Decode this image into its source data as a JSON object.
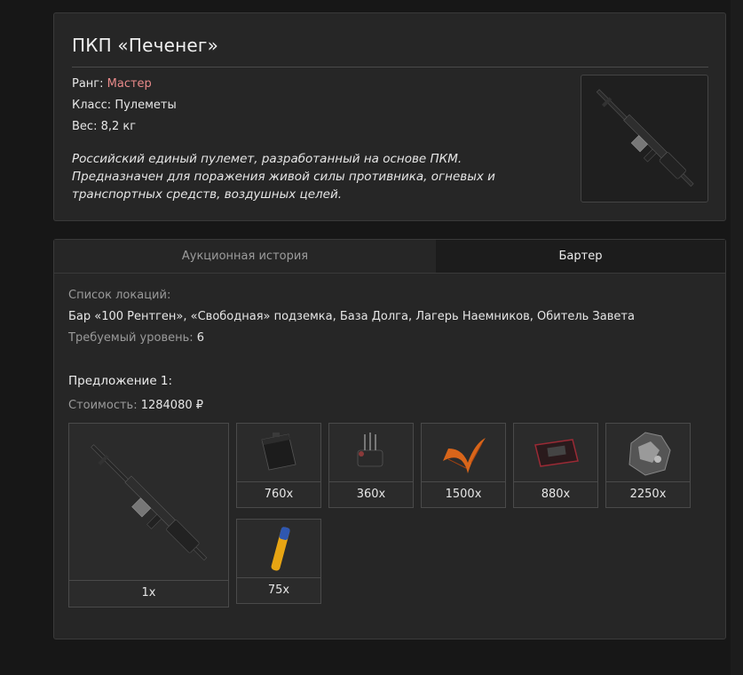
{
  "item": {
    "title": "ПКП «Печенег»",
    "rank_label": "Ранг:",
    "rank_value": "Мастер",
    "class_label": "Класс:",
    "class_value": "Пулеметы",
    "weight_label": "Вес:",
    "weight_value": "8,2 кг",
    "description": "Российский единый пулемет, разработанный на основе ПКМ. Предназначен для поражения живой силы противника, огневых и транспортных средств, воздушных целей.",
    "rank_color": "#e98a8a"
  },
  "tabs": [
    {
      "label": "Аукционная история",
      "active": false
    },
    {
      "label": "Бартер",
      "active": true
    }
  ],
  "barter": {
    "locations_label": "Список локаций:",
    "locations_value": "Бар «100 Рентген», «Свободная» подземка, База Долга, Лагерь Наемников, Обитель Завета",
    "level_label": "Требуемый уровень:",
    "level_value": "6",
    "offer_title": "Предложение 1:",
    "cost_label": "Стоимость:",
    "cost_value": "1284080 ₽",
    "result": {
      "count": "1x",
      "icon": "machine-gun-icon"
    },
    "ingredients": [
      {
        "count": "760x",
        "icon": "black-case-icon"
      },
      {
        "count": "360x",
        "icon": "device-component-icon"
      },
      {
        "count": "1500x",
        "icon": "orange-fern-icon"
      },
      {
        "count": "880x",
        "icon": "red-tablet-icon"
      },
      {
        "count": "2250x",
        "icon": "ore-chunk-icon"
      },
      {
        "count": "75x",
        "icon": "vial-icon"
      }
    ]
  }
}
